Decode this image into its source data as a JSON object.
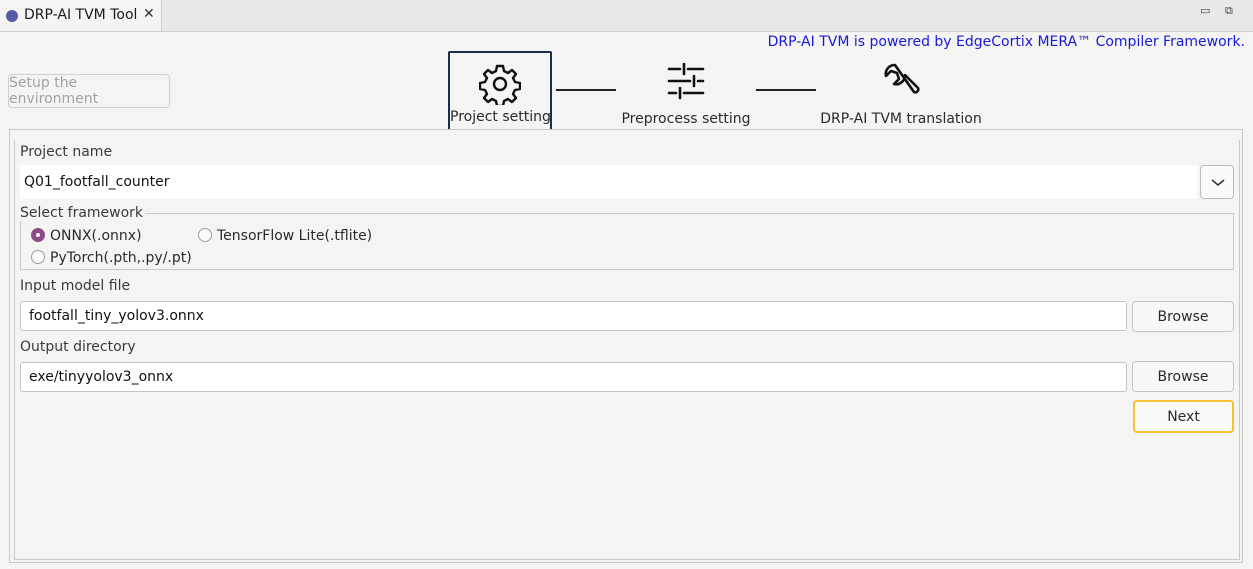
{
  "tab": {
    "title": "DRP-AI TVM Tool",
    "close_glyph": "✕"
  },
  "window_controls": {
    "minimize": "▭",
    "restore": "⧉"
  },
  "powered_by": "DRP-AI TVM is powered by EdgeCortix MERA™ Compiler Framework.",
  "setup_button": "Setup the environment",
  "steps": [
    {
      "label": "Project setting",
      "icon": "gear-icon",
      "active": true
    },
    {
      "label": "Preprocess setting",
      "icon": "sliders-icon",
      "active": false
    },
    {
      "label": "DRP-AI TVM translation",
      "icon": "wrench-icon",
      "active": false
    }
  ],
  "form": {
    "project_name_label": "Project name",
    "project_name_value": "Q01_footfall_counter",
    "framework_label": "Select framework",
    "framework_options": [
      {
        "label": "ONNX(.onnx)",
        "selected": true
      },
      {
        "label": "TensorFlow Lite(.tflite)",
        "selected": false
      },
      {
        "label": "PyTorch(.pth,.py/.pt)",
        "selected": false
      }
    ],
    "input_model_label": "Input model file",
    "input_model_value": "footfall_tiny_yolov3.onnx",
    "output_dir_label": "Output directory",
    "output_dir_value": "exe/tinyyolov3_onnx",
    "browse_label": "Browse",
    "next_label": "Next"
  },
  "colors": {
    "accent_radio": "#8e4a86",
    "powered_link": "#1a1ad6",
    "next_focus": "#f2c430",
    "active_step_border": "#1c2b4d"
  }
}
